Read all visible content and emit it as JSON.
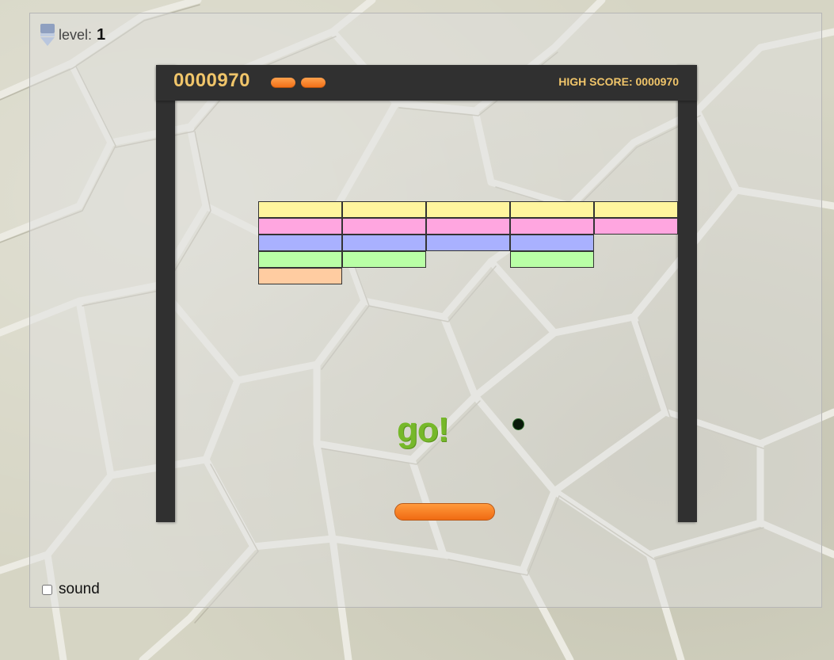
{
  "hud": {
    "level_label": "level:",
    "level_value": "1",
    "score": "0000970",
    "lives": 2,
    "high_score": "HIGH SCORE: 0000970"
  },
  "message": "go!",
  "sound": {
    "label": "sound",
    "checked": false
  },
  "bricks": {
    "columns": 5,
    "rows": [
      {
        "color": "#fff59e",
        "cells": [
          1,
          1,
          1,
          1,
          1
        ]
      },
      {
        "color": "#ffa6e0",
        "cells": [
          1,
          1,
          1,
          1,
          1
        ]
      },
      {
        "color": "#a9b1ff",
        "cells": [
          1,
          1,
          1,
          1,
          0
        ]
      },
      {
        "color": "#b9ffa6",
        "cells": [
          1,
          1,
          0,
          1,
          0
        ]
      },
      {
        "color": "#ffcca1",
        "cells": [
          1,
          0,
          0,
          0,
          0
        ]
      }
    ]
  },
  "colors": {
    "frame": "#303030",
    "hud_text": "#f0c56a",
    "paddle": "#f47820",
    "go_text": "#76b82a",
    "ball": "#0a1a0a"
  },
  "icons": {
    "level": "level-down-arrow-icon"
  }
}
